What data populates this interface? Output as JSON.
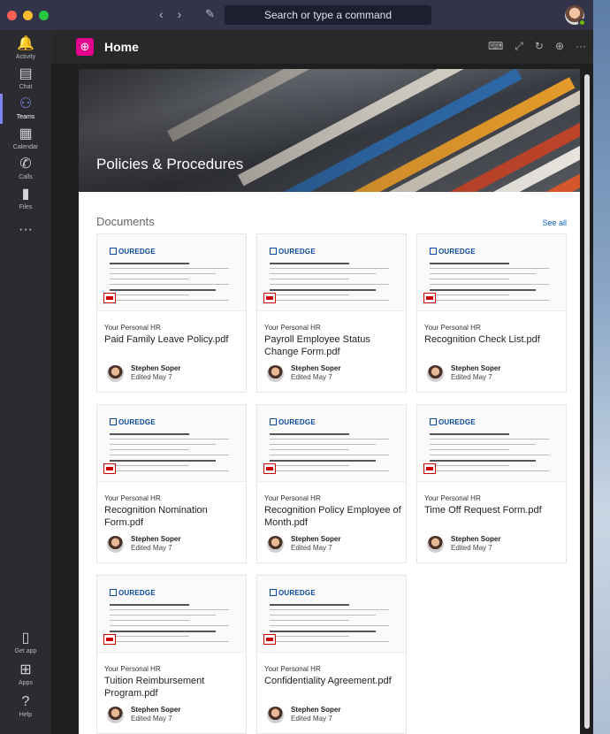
{
  "titlebar": {
    "back_icon": "chevron-left",
    "forward_icon": "chevron-right",
    "compose_icon": "new-window",
    "search_placeholder": "Search or type a command"
  },
  "rail": {
    "items": [
      {
        "label": "Activity",
        "icon": "bell-icon",
        "glyph": "🔔"
      },
      {
        "label": "Chat",
        "icon": "chat-icon",
        "glyph": "▤"
      },
      {
        "label": "Teams",
        "icon": "teams-icon",
        "glyph": "⚇",
        "active": true
      },
      {
        "label": "Calendar",
        "icon": "calendar-icon",
        "glyph": "▦"
      },
      {
        "label": "Calls",
        "icon": "phone-icon",
        "glyph": "✆"
      },
      {
        "label": "Files",
        "icon": "file-icon",
        "glyph": "▮"
      },
      {
        "label": "",
        "icon": "more-icon",
        "glyph": "···"
      }
    ],
    "bottom_items": [
      {
        "label": "Get app",
        "icon": "device-icon",
        "glyph": "▯"
      },
      {
        "label": "Apps",
        "icon": "apps-icon",
        "glyph": "⊞"
      },
      {
        "label": "Help",
        "icon": "help-icon",
        "glyph": "?"
      }
    ]
  },
  "header": {
    "title": "Home",
    "app_icon_glyph": "⊕",
    "actions": [
      "⌨",
      "⤢",
      "↻",
      "⊕",
      "···"
    ]
  },
  "hero": {
    "title": "Policies & Procedures"
  },
  "documents": {
    "section_title": "Documents",
    "see_all": "See all",
    "logo_text": "OUREDGE",
    "items": [
      {
        "site": "Your Personal HR",
        "title": "Paid Family Leave Policy.pdf",
        "author": "Stephen Soper",
        "edited": "Edited May 7"
      },
      {
        "site": "Your Personal HR",
        "title": "Payroll Employee Status Change Form.pdf",
        "author": "Stephen Soper",
        "edited": "Edited May 7"
      },
      {
        "site": "Your Personal HR",
        "title": "Recognition Check List.pdf",
        "author": "Stephen Soper",
        "edited": "Edited May 7"
      },
      {
        "site": "Your Personal HR",
        "title": "Recognition Nomination Form.pdf",
        "author": "Stephen Soper",
        "edited": "Edited May 7"
      },
      {
        "site": "Your Personal HR",
        "title": "Recognition Policy Employee of Month.pdf",
        "author": "Stephen Soper",
        "edited": "Edited May 7"
      },
      {
        "site": "Your Personal HR",
        "title": "Time Off Request Form.pdf",
        "author": "Stephen Soper",
        "edited": "Edited May 7"
      },
      {
        "site": "Your Personal HR",
        "title": "Tuition Reimbursement Program.pdf",
        "author": "Stephen Soper",
        "edited": "Edited May 7"
      },
      {
        "site": "Your Personal HR",
        "title": "Confidentiality Agreement.pdf",
        "author": "Stephen Soper",
        "edited": "Edited May 7"
      }
    ]
  },
  "colors": {
    "accent": "#7f85f5",
    "app_icon": "#e3008c",
    "link": "#0b62c2"
  }
}
